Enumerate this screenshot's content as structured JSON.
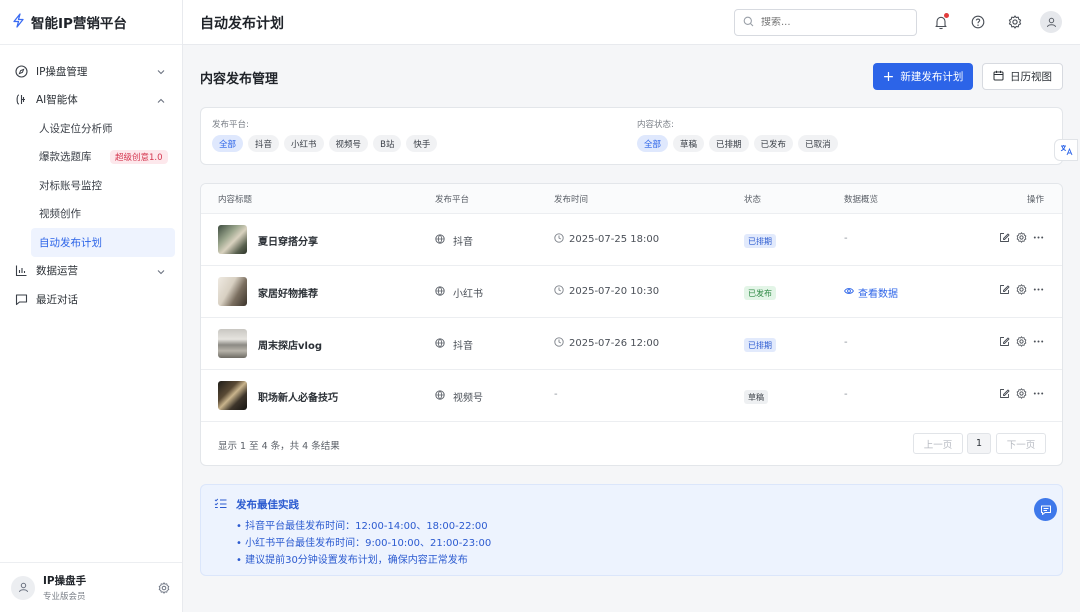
{
  "app": {
    "logo_icon": "lightning-icon",
    "name": "智能IP营销平台"
  },
  "sidebar": {
    "items": [
      {
        "label": "IP操盘管理",
        "icon": "compass-icon"
      },
      {
        "label": "AI智能体",
        "icon": "ai-agent-icon"
      },
      {
        "label": "数据运营",
        "icon": "bar-chart-icon"
      },
      {
        "label": "最近对话",
        "icon": "chat-icon"
      }
    ],
    "sub_items": [
      {
        "label": "人设定位分析师"
      },
      {
        "label": "爆款选题库",
        "badge": "超级创意1.0"
      },
      {
        "label": "对标账号监控"
      },
      {
        "label": "视频创作"
      },
      {
        "label": "自动发布计划"
      }
    ],
    "user": {
      "name": "IP操盘手",
      "role": "专业版会员"
    }
  },
  "header": {
    "title": "自动发布计划",
    "search_placeholder": "搜索..."
  },
  "main": {
    "title": "内容发布管理",
    "new_button": "新建发布计划",
    "calendar_button": "日历视图"
  },
  "filters": {
    "platform_label": "发布平台:",
    "platforms": [
      "全部",
      "抖音",
      "小红书",
      "视频号",
      "B站",
      "快手"
    ],
    "status_label": "内容状态:",
    "statuses": [
      "全部",
      "草稿",
      "已排期",
      "已发布",
      "已取消"
    ]
  },
  "table": {
    "columns": [
      "内容标题",
      "发布平台",
      "发布时间",
      "状态",
      "数据概览",
      "操作"
    ],
    "rows": [
      {
        "title": "夏日穿搭分享",
        "platform": "抖音",
        "time": "2025-07-25 18:00",
        "status": "已排期",
        "data": "-"
      },
      {
        "title": "家居好物推荐",
        "platform": "小红书",
        "time": "2025-07-20 10:30",
        "status": "已发布",
        "data": "查看数据"
      },
      {
        "title": "周末探店vlog",
        "platform": "抖音",
        "time": "2025-07-26 12:00",
        "status": "已排期",
        "data": "-"
      },
      {
        "title": "职场新人必备技巧",
        "platform": "视频号",
        "time": "-",
        "status": "草稿",
        "data": "-"
      }
    ],
    "summary": "显示 1 至 4 条，共 4 条结果",
    "prev": "上一页",
    "page": "1",
    "next": "下一页"
  },
  "tips": {
    "title": "发布最佳实践",
    "items": [
      "• 抖音平台最佳发布时间：12:00-14:00、18:00-22:00",
      "• 小红书平台最佳发布时间：9:00-10:00、21:00-23:00",
      "• 建议提前30分钟设置发布计划，确保内容正常发布"
    ]
  },
  "colors": {
    "accent": "#2c64e8",
    "scheduled": "#2c5bd0",
    "published": "#2f8a45"
  },
  "floating": {
    "translate_icon": "translate-icon",
    "chat_icon": "chat-bubble-icon"
  }
}
